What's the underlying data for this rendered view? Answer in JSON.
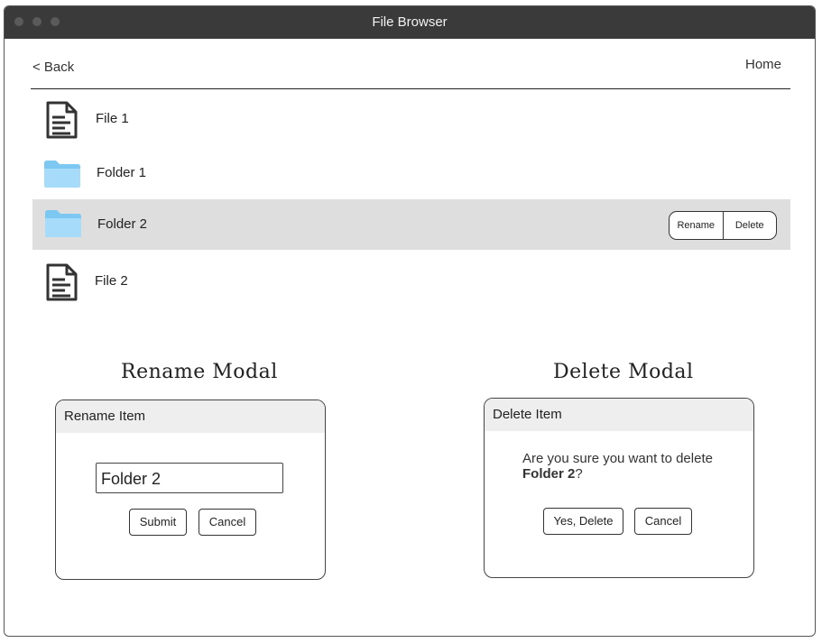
{
  "window": {
    "title": "File Browser"
  },
  "nav": {
    "back_label": "< Back",
    "home_label": "Home"
  },
  "items": [
    {
      "type": "file",
      "name": "File 1"
    },
    {
      "type": "folder",
      "name": "Folder 1"
    },
    {
      "type": "folder",
      "name": "Folder 2",
      "selected": true,
      "actions": [
        "Rename",
        "Delete"
      ]
    },
    {
      "type": "file",
      "name": "File 2"
    }
  ],
  "rename_section": {
    "heading": "Rename Modal",
    "modal_title": "Rename Item",
    "input_value": "Folder 2",
    "submit_label": "Submit",
    "cancel_label": "Cancel"
  },
  "delete_section": {
    "heading": "Delete Modal",
    "modal_title": "Delete Item",
    "message": "Are you sure you want to delete",
    "item_name": "Folder 2",
    "message_suffix": "?",
    "confirm_label": "Yes, Delete",
    "cancel_label": "Cancel"
  },
  "colors": {
    "titlebar": "#3a3a3a",
    "selected_row": "#dedede",
    "folder": "#8fd3f7",
    "modal_header": "#eeeeee"
  }
}
